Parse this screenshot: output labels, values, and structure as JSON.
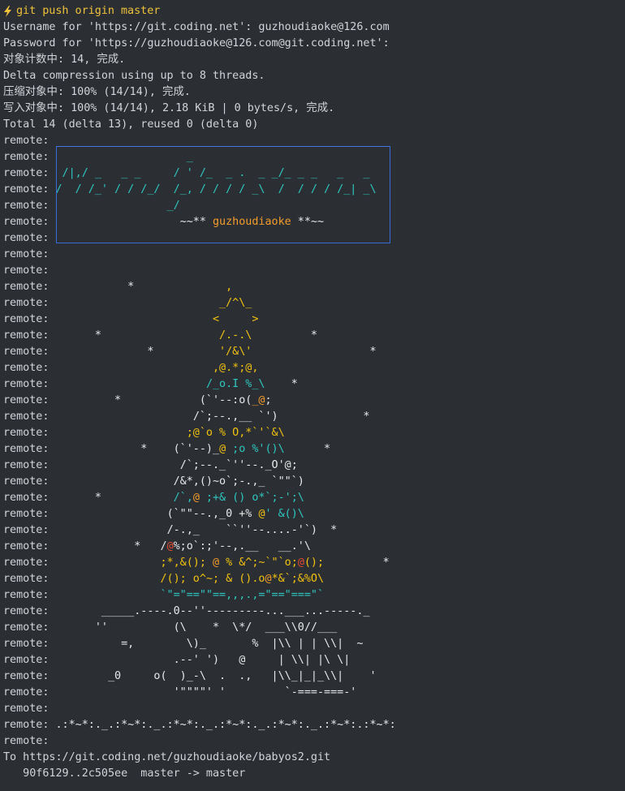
{
  "terminal": {
    "colors": {
      "background": "#2b2f34",
      "text": "#d1d4d8",
      "prompt": "#f0c23a",
      "cyan": "#2ec7c0",
      "yellow": "#f2c20d",
      "orange": "#f59c2a",
      "red": "#e64a2e",
      "banner_border": "#3a6ad9"
    },
    "prompt_icon": "lightning-bolt-icon",
    "lines": [
      [
        {
          "t": "git push origin master",
          "c": "prompt"
        }
      ],
      [
        {
          "t": "Username for 'https://git.coding.net': guzhoudiaoke@126.com",
          "c": "default"
        }
      ],
      [
        {
          "t": "Password for 'https://guzhoudiaoke@126.com@git.coding.net':",
          "c": "default"
        }
      ],
      [
        {
          "t": "对象计数中: 14, 完成.",
          "c": "default"
        }
      ],
      [
        {
          "t": "Delta compression using up to 8 threads.",
          "c": "default"
        }
      ],
      [
        {
          "t": "压缩对象中: 100% (14/14), 完成.",
          "c": "default"
        }
      ],
      [
        {
          "t": "写入对象中: 100% (14/14), 2.18 KiB | 0 bytes/s, 完成.",
          "c": "default"
        }
      ],
      [
        {
          "t": "Total 14 (delta 13), reused 0 (delta 0)",
          "c": "default"
        }
      ],
      [
        {
          "t": "remote: ",
          "c": "default"
        }
      ],
      [
        {
          "t": "remote: ",
          "c": "default"
        },
        {
          "t": "                    _",
          "c": "cyan"
        }
      ],
      [
        {
          "t": "remote: ",
          "c": "default"
        },
        {
          "t": " /|,/ _   _ _     / ' /_  _ .  _ _/_ _ _   _   _",
          "c": "cyan"
        }
      ],
      [
        {
          "t": "remote: ",
          "c": "default"
        },
        {
          "t": "/  / /_' / / /_/  /_, / / / / _\\  /  / / / /_| _\\",
          "c": "cyan"
        }
      ],
      [
        {
          "t": "remote: ",
          "c": "default"
        },
        {
          "t": "                 _/",
          "c": "cyan"
        }
      ],
      [
        {
          "t": "remote: ",
          "c": "default"
        },
        {
          "t": "                   ~~** ",
          "c": "white"
        },
        {
          "t": "guzhoudiaoke",
          "c": "orange"
        },
        {
          "t": " **~~",
          "c": "white"
        }
      ],
      [
        {
          "t": "remote: ",
          "c": "default"
        }
      ],
      [
        {
          "t": "remote: ",
          "c": "default"
        }
      ],
      [
        {
          "t": "remote: ",
          "c": "default"
        }
      ],
      [
        {
          "t": "remote: ",
          "c": "default"
        },
        {
          "t": "           *              ",
          "c": "white"
        },
        {
          "t": ",",
          "c": "yellow"
        }
      ],
      [
        {
          "t": "remote: ",
          "c": "default"
        },
        {
          "t": "                         ",
          "c": "white"
        },
        {
          "t": "_/^\\_",
          "c": "yellow"
        }
      ],
      [
        {
          "t": "remote: ",
          "c": "default"
        },
        {
          "t": "                        ",
          "c": "white"
        },
        {
          "t": "<     >",
          "c": "yellow"
        }
      ],
      [
        {
          "t": "remote: ",
          "c": "default"
        },
        {
          "t": "      *                  ",
          "c": "white"
        },
        {
          "t": "/.-.\\",
          "c": "yellow"
        },
        {
          "t": "         *",
          "c": "white"
        }
      ],
      [
        {
          "t": "remote: ",
          "c": "default"
        },
        {
          "t": "              *          ",
          "c": "white"
        },
        {
          "t": "'/&\\'",
          "c": "yellow"
        },
        {
          "t": "                  *",
          "c": "white"
        }
      ],
      [
        {
          "t": "remote: ",
          "c": "default"
        },
        {
          "t": "                        ",
          "c": "white"
        },
        {
          "t": ",@.*;@,",
          "c": "yellow"
        }
      ],
      [
        {
          "t": "remote: ",
          "c": "default"
        },
        {
          "t": "                       ",
          "c": "white"
        },
        {
          "t": "/_o.I %_\\",
          "c": "cyan"
        },
        {
          "t": "    *",
          "c": "white"
        }
      ],
      [
        {
          "t": "remote: ",
          "c": "default"
        },
        {
          "t": "         *            ",
          "c": "white"
        },
        {
          "t": "(`'--:o(",
          "c": "white"
        },
        {
          "t": "_@",
          "c": "orange"
        },
        {
          "t": ";",
          "c": "white"
        }
      ],
      [
        {
          "t": "remote: ",
          "c": "default"
        },
        {
          "t": "                     ",
          "c": "white"
        },
        {
          "t": "/`;--.,__ `')",
          "c": "white"
        },
        {
          "t": "             *",
          "c": "white"
        }
      ],
      [
        {
          "t": "remote: ",
          "c": "default"
        },
        {
          "t": "                    ",
          "c": "white"
        },
        {
          "t": ";@`o % O,*`'`&\\",
          "c": "yellow"
        }
      ],
      [
        {
          "t": "remote: ",
          "c": "default"
        },
        {
          "t": "             *    ",
          "c": "white"
        },
        {
          "t": "(`'--)_",
          "c": "white"
        },
        {
          "t": "@",
          "c": "yellow"
        },
        {
          "t": " ;o %'()\\",
          "c": "cyan"
        },
        {
          "t": "      *",
          "c": "white"
        }
      ],
      [
        {
          "t": "remote: ",
          "c": "default"
        },
        {
          "t": "                   ",
          "c": "white"
        },
        {
          "t": "/`;--._`''--._O'@;",
          "c": "white"
        }
      ],
      [
        {
          "t": "remote: ",
          "c": "default"
        },
        {
          "t": "                  ",
          "c": "white"
        },
        {
          "t": "/&*,()~o`;-.,_ `\"\"`)",
          "c": "white"
        }
      ],
      [
        {
          "t": "remote: ",
          "c": "default"
        },
        {
          "t": "      *           ",
          "c": "white"
        },
        {
          "t": "/`,",
          "c": "cyan"
        },
        {
          "t": "@",
          "c": "orange"
        },
        {
          "t": " ;+& () o*`;-';\\",
          "c": "cyan"
        }
      ],
      [
        {
          "t": "remote: ",
          "c": "default"
        },
        {
          "t": "                 ",
          "c": "white"
        },
        {
          "t": "(`\"\"--.,_0 +% ",
          "c": "white"
        },
        {
          "t": "@",
          "c": "yellow"
        },
        {
          "t": "' &()\\",
          "c": "cyan"
        }
      ],
      [
        {
          "t": "remote: ",
          "c": "default"
        },
        {
          "t": "                 ",
          "c": "white"
        },
        {
          "t": "/-.,_    ``''--....-'`)",
          "c": "white"
        },
        {
          "t": "  *",
          "c": "white"
        }
      ],
      [
        {
          "t": "remote: ",
          "c": "default"
        },
        {
          "t": "            *   ",
          "c": "white"
        },
        {
          "t": "/",
          "c": "white"
        },
        {
          "t": "@",
          "c": "red"
        },
        {
          "t": "%;o`:;'--,.__   __.'\\",
          "c": "white"
        }
      ],
      [
        {
          "t": "remote: ",
          "c": "default"
        },
        {
          "t": "                ",
          "c": "white"
        },
        {
          "t": ";*,&(); ",
          "c": "yellow"
        },
        {
          "t": "@",
          "c": "orange"
        },
        {
          "t": " % &^;~`\"`o;",
          "c": "yellow"
        },
        {
          "t": "@",
          "c": "red"
        },
        {
          "t": "();",
          "c": "yellow"
        },
        {
          "t": "         *",
          "c": "white"
        }
      ],
      [
        {
          "t": "remote: ",
          "c": "default"
        },
        {
          "t": "                ",
          "c": "white"
        },
        {
          "t": "/(); o^~; & ().o",
          "c": "yellow"
        },
        {
          "t": "@",
          "c": "orange"
        },
        {
          "t": "*&`;&%O\\",
          "c": "yellow"
        }
      ],
      [
        {
          "t": "remote: ",
          "c": "default"
        },
        {
          "t": "                ",
          "c": "white"
        },
        {
          "t": "`\"=\"==\"\"==,,,.,=\"==\"===\"`",
          "c": "cyan"
        }
      ],
      [
        {
          "t": "remote: ",
          "c": "default"
        },
        {
          "t": "       _____.----.0--''---------...___...-----._",
          "c": "white"
        }
      ],
      [
        {
          "t": "remote: ",
          "c": "default"
        },
        {
          "t": "      ''          (\\    *  \\*/  ___\\\\0//___",
          "c": "white"
        }
      ],
      [
        {
          "t": "remote: ",
          "c": "default"
        },
        {
          "t": "          =,        \\)_       %  |\\\\ | | \\\\|  ~",
          "c": "white"
        }
      ],
      [
        {
          "t": "remote: ",
          "c": "default"
        },
        {
          "t": "                  .--' ')   @     | \\\\| |\\ \\|",
          "c": "white"
        }
      ],
      [
        {
          "t": "remote: ",
          "c": "default"
        },
        {
          "t": "        _0     o(  )_-\\  .  .,   |\\\\_|_|_\\\\|    '",
          "c": "white"
        }
      ],
      [
        {
          "t": "remote: ",
          "c": "default"
        },
        {
          "t": "                  '\"\"\"\"' '         `-===-===-'",
          "c": "white"
        }
      ],
      [
        {
          "t": "remote: ",
          "c": "default"
        }
      ],
      [
        {
          "t": "remote: ",
          "c": "default"
        },
        {
          "t": ".:*~*:._.:*~*:._.:*~*:._.:*~*:._.:*~*:._.:*~*:.:*~*:",
          "c": "white"
        }
      ],
      [
        {
          "t": "remote: ",
          "c": "default"
        }
      ],
      [
        {
          "t": "To https://git.coding.net/guzhoudiaoke/babyos2.git",
          "c": "default"
        }
      ],
      [
        {
          "t": "   90f6129..2c505ee  master -> master",
          "c": "default"
        }
      ]
    ]
  }
}
